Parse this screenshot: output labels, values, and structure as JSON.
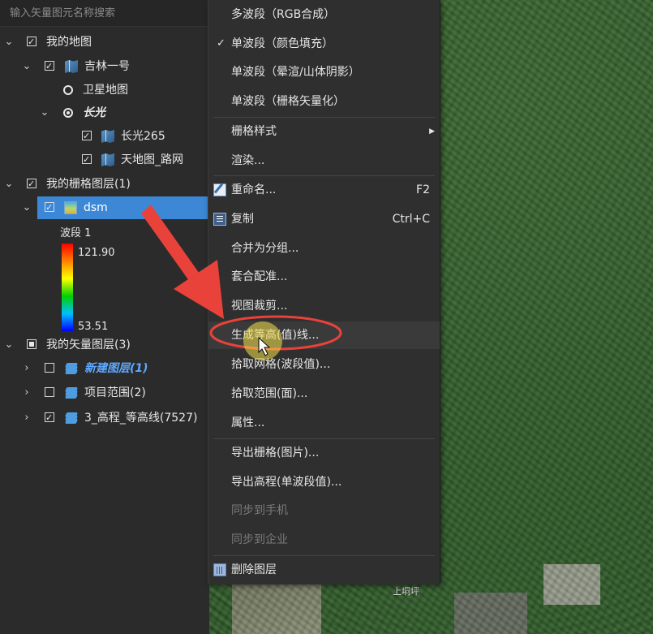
{
  "search": {
    "placeholder": "输入矢量图元名称搜索"
  },
  "tree": {
    "my_maps": "我的地图",
    "jilin": "吉林一号",
    "satellite": "卫星地图",
    "changguang": "长光",
    "cg265": "长光265",
    "tianditu": "天地图_路网",
    "raster_group": "我的栅格图层(1)",
    "dsm": "dsm",
    "band": "波段 1",
    "ramp_max": "121.90",
    "ramp_min": "53.51",
    "vector_group": "我的矢量图层(3)",
    "new_layer": "新建图层(1)",
    "project_range": "项目范围(2)",
    "contour": "3_高程_等高线(7527)"
  },
  "menu": {
    "multiband": "多波段（RGB合成）",
    "single_color": "单波段（颜色填充）",
    "single_shade": "单波段（晕渲/山体阴影）",
    "single_vector": "单波段（栅格矢量化）",
    "raster_style": "栅格样式",
    "render": "渲染...",
    "rename": "重命名...",
    "rename_key": "F2",
    "copy": "复制",
    "copy_key": "Ctrl+C",
    "merge_group": "合并为分组...",
    "registration": "套合配准...",
    "view_clip": "视图裁剪...",
    "gen_contour": "生成等高(值)线...",
    "pick_grid": "拾取网格(波段值)...",
    "pick_range": "拾取范围(面)...",
    "properties": "属性...",
    "export_raster": "导出栅格(图片)...",
    "export_elev": "导出高程(单波段值)...",
    "sync_phone": "同步到手机",
    "sync_company": "同步到企业",
    "delete_layer": "删除图层"
  },
  "map": {
    "place_label": "上垌坪"
  },
  "colors": {
    "selection": "#3c88d6",
    "annotation": "#e8423a",
    "cursor_highlight": "#f4e04a"
  }
}
